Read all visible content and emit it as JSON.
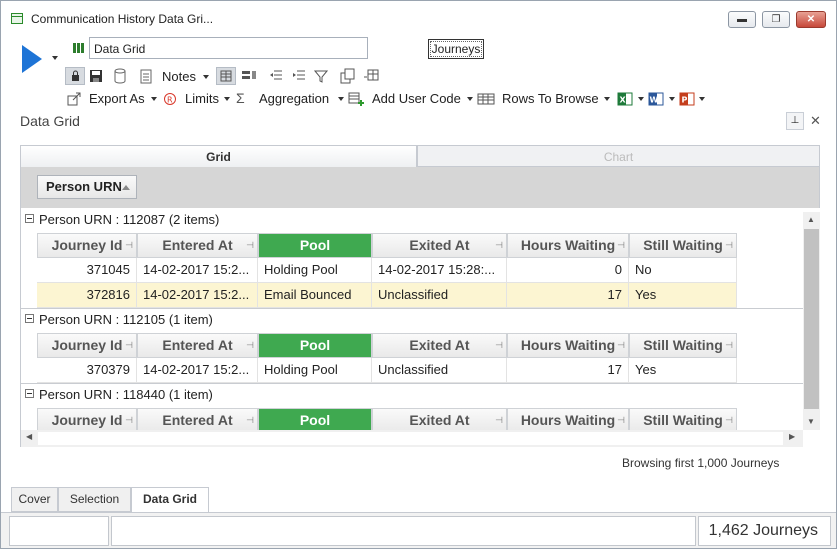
{
  "window": {
    "title": "Communication History Data Gri...",
    "min_label": "▬",
    "max_label": "❐",
    "close_label": "✕"
  },
  "toolbar": {
    "view_name": "Data Grid",
    "journeys_button": "Journeys",
    "notes_label": "Notes",
    "export_label": "Export As",
    "limits_label": "Limits",
    "aggregation_label": "Aggregation",
    "add_user_code_label": "Add User Code",
    "rows_to_browse_label": "Rows To Browse"
  },
  "panel": {
    "title": "Data Grid",
    "tabs": [
      "Grid",
      "Chart"
    ],
    "active_tab": "Grid"
  },
  "grid": {
    "group_by": "Person URN",
    "columns": [
      "Journey Id",
      "Entered At",
      "Pool",
      "Exited At",
      "Hours Waiting",
      "Still Waiting"
    ],
    "highlight_column": "Pool",
    "groups": [
      {
        "label": "Person URN : 112087 (2 items)",
        "rows": [
          {
            "journey_id": "371045",
            "entered_at": "14-02-2017  15:2...",
            "pool": "Holding Pool",
            "exited_at": "14-02-2017  15:28:...",
            "hours_waiting": "0",
            "still_waiting": "No"
          },
          {
            "journey_id": "372816",
            "entered_at": "14-02-2017  15:2...",
            "pool": "Email Bounced",
            "exited_at": "Unclassified",
            "hours_waiting": "17",
            "still_waiting": "Yes"
          }
        ]
      },
      {
        "label": "Person URN : 112105 (1 item)",
        "rows": [
          {
            "journey_id": "370379",
            "entered_at": "14-02-2017  15:2...",
            "pool": "Holding Pool",
            "exited_at": "Unclassified",
            "hours_waiting": "17",
            "still_waiting": "Yes"
          }
        ]
      },
      {
        "label": "Person URN : 118440 (1 item)",
        "rows": []
      }
    ],
    "selected_row": "372816"
  },
  "status": {
    "browsing_text": "Browsing first 1,000 Journeys",
    "count_text": "1,462 Journeys"
  },
  "bottom_tabs": [
    "Cover",
    "Selection",
    "Data Grid"
  ],
  "active_bottom_tab": "Data Grid",
  "colors": {
    "pool_header": "#3fa950",
    "selected_row": "#fcf5d2",
    "run_button": "#1e74d6"
  }
}
